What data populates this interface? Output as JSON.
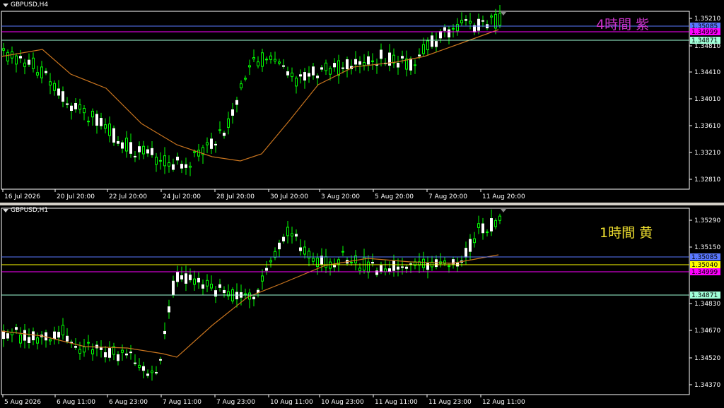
{
  "colors": {
    "background": "#000000",
    "axis": "#ffffff",
    "bull": "#00ff00",
    "bear": "#ffffff",
    "ma": "#c8741e",
    "tf_h4_label": "#cc33cc",
    "tf_h1_label": "#f0e030",
    "line_blue": "#5a78ff",
    "line_magenta": "#ff00ff",
    "line_aqua": "#a0ffd8",
    "line_yellow": "#ffff00"
  },
  "top": {
    "symbol": "GBPUSD,H4",
    "tf_label": "4時間  紫",
    "y_ticks": [
      "1.35210",
      "1.34810",
      "1.34410",
      "1.34010",
      "1.33610",
      "1.33210",
      "1.32810"
    ],
    "x_ticks": [
      "16 Jul 2026",
      "20 Jul 20:00",
      "22 Jul 20:00",
      "24 Jul 20:00",
      "28 Jul 20:00",
      "30 Jul 20:00",
      "3 Aug 20:00",
      "5 Aug 20:00",
      "7 Aug 20:00",
      "11 Aug 20:00"
    ],
    "hlines": [
      {
        "label": "1.35085",
        "color": "#5a78ff"
      },
      {
        "label": "1.34999",
        "color": "#ff00ff"
      },
      {
        "label": "1.34871",
        "color": "#a0ffd8"
      }
    ]
  },
  "bottom": {
    "symbol": "GBPUSD,H1",
    "tf_label": "1時間  黄",
    "y_ticks": [
      "1.35290",
      "1.35150",
      "1.34830",
      "1.34670",
      "1.34520",
      "1.34370"
    ],
    "x_ticks": [
      "5 Aug 2026",
      "6 Aug 11:00",
      "6 Aug 23:00",
      "7 Aug 11:00",
      "7 Aug 23:00",
      "10 Aug 11:00",
      "10 Aug 23:00",
      "11 Aug 11:00",
      "11 Aug 23:00",
      "12 Aug 11:00"
    ],
    "hlines": [
      {
        "label": "1.35085",
        "color": "#5a78ff"
      },
      {
        "label": "1.35040",
        "color": "#ffff00"
      },
      {
        "label": "1.34999",
        "color": "#ff00ff"
      },
      {
        "label": "1.34871",
        "color": "#a0ffd8"
      }
    ]
  }
}
